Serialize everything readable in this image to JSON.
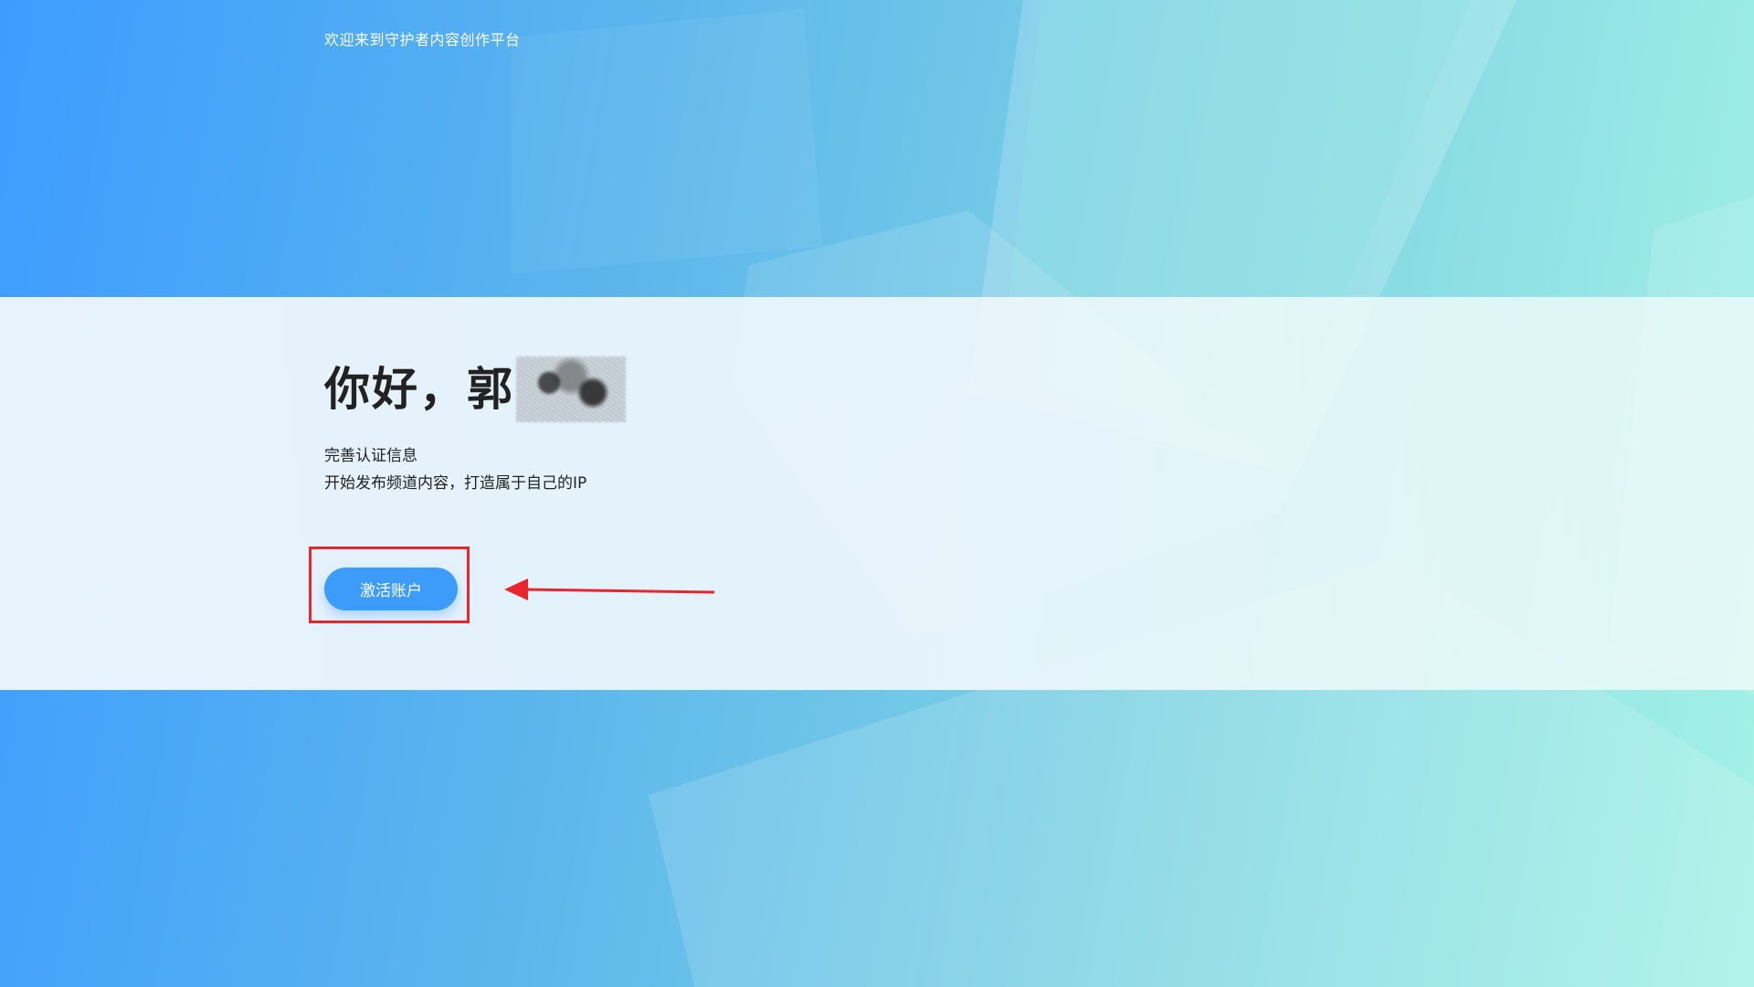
{
  "header": {
    "welcome_text": "欢迎来到守护者内容创作平台"
  },
  "hero": {
    "greeting": "你好，郭",
    "subtitle_line1": "完善认证信息",
    "subtitle_line2": "开始发布频道内容，打造属于自己的IP",
    "activate_button_label": "激活账户"
  },
  "colors": {
    "primary_button": "#3d9bfa",
    "annotation_red": "#e8262b",
    "gradient_start": "#3d9cff",
    "gradient_end": "#a4f2e6"
  },
  "icons": {
    "annotation_arrow": "arrow-left-icon"
  }
}
